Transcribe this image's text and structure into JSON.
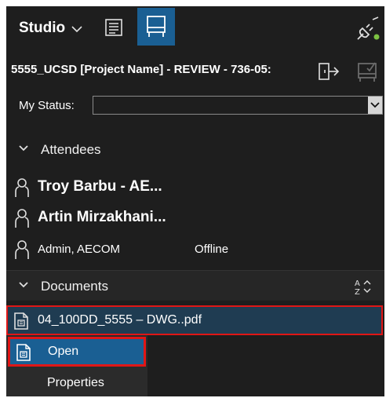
{
  "toolbar": {
    "studio_label": "Studio",
    "icons": [
      "chevron-down-icon",
      "notes-icon",
      "layout-panel-icon",
      "connection-status-icon"
    ],
    "active_color": "#1a5f93",
    "status_dot_color": "#7dc242"
  },
  "session": {
    "title": "5555_UCSD [Project Name] - REVIEW - 736-05:",
    "icons": [
      "leave-session-icon",
      "finish-review-icon"
    ]
  },
  "status": {
    "label": "My Status:",
    "value": ""
  },
  "attendees": {
    "header": "Attendees",
    "items": [
      {
        "name": "Troy Barbu - AE...",
        "presence": ""
      },
      {
        "name": "Artin Mirzakhani...",
        "presence": ""
      },
      {
        "name": "Admin, AECOM",
        "presence": "Offline"
      }
    ]
  },
  "documents": {
    "header": "Documents",
    "items": [
      {
        "name": "04_100DD_5555 – DWG..pdf"
      }
    ]
  },
  "context_menu": {
    "items": [
      {
        "label": "Open"
      },
      {
        "label": "Properties"
      }
    ]
  },
  "colors": {
    "background": "#1e1e1e",
    "selection": "#1f3c52",
    "highlight_border": "#e01616"
  }
}
